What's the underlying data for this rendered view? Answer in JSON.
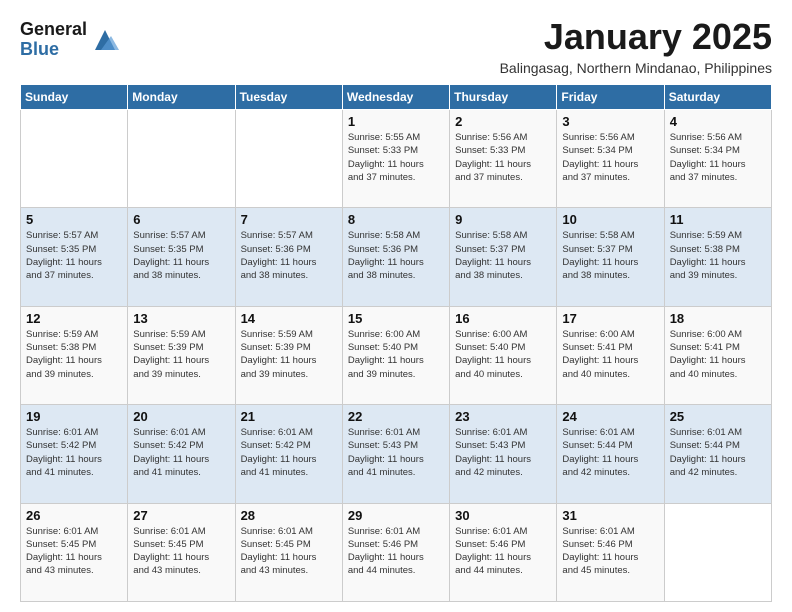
{
  "logo": {
    "line1": "General",
    "line2": "Blue"
  },
  "title": "January 2025",
  "subtitle": "Balingasag, Northern Mindanao, Philippines",
  "days_of_week": [
    "Sunday",
    "Monday",
    "Tuesday",
    "Wednesday",
    "Thursday",
    "Friday",
    "Saturday"
  ],
  "weeks": [
    [
      {
        "day": "",
        "info": ""
      },
      {
        "day": "",
        "info": ""
      },
      {
        "day": "",
        "info": ""
      },
      {
        "day": "1",
        "info": "Sunrise: 5:55 AM\nSunset: 5:33 PM\nDaylight: 11 hours\nand 37 minutes."
      },
      {
        "day": "2",
        "info": "Sunrise: 5:56 AM\nSunset: 5:33 PM\nDaylight: 11 hours\nand 37 minutes."
      },
      {
        "day": "3",
        "info": "Sunrise: 5:56 AM\nSunset: 5:34 PM\nDaylight: 11 hours\nand 37 minutes."
      },
      {
        "day": "4",
        "info": "Sunrise: 5:56 AM\nSunset: 5:34 PM\nDaylight: 11 hours\nand 37 minutes."
      }
    ],
    [
      {
        "day": "5",
        "info": "Sunrise: 5:57 AM\nSunset: 5:35 PM\nDaylight: 11 hours\nand 37 minutes."
      },
      {
        "day": "6",
        "info": "Sunrise: 5:57 AM\nSunset: 5:35 PM\nDaylight: 11 hours\nand 38 minutes."
      },
      {
        "day": "7",
        "info": "Sunrise: 5:57 AM\nSunset: 5:36 PM\nDaylight: 11 hours\nand 38 minutes."
      },
      {
        "day": "8",
        "info": "Sunrise: 5:58 AM\nSunset: 5:36 PM\nDaylight: 11 hours\nand 38 minutes."
      },
      {
        "day": "9",
        "info": "Sunrise: 5:58 AM\nSunset: 5:37 PM\nDaylight: 11 hours\nand 38 minutes."
      },
      {
        "day": "10",
        "info": "Sunrise: 5:58 AM\nSunset: 5:37 PM\nDaylight: 11 hours\nand 38 minutes."
      },
      {
        "day": "11",
        "info": "Sunrise: 5:59 AM\nSunset: 5:38 PM\nDaylight: 11 hours\nand 39 minutes."
      }
    ],
    [
      {
        "day": "12",
        "info": "Sunrise: 5:59 AM\nSunset: 5:38 PM\nDaylight: 11 hours\nand 39 minutes."
      },
      {
        "day": "13",
        "info": "Sunrise: 5:59 AM\nSunset: 5:39 PM\nDaylight: 11 hours\nand 39 minutes."
      },
      {
        "day": "14",
        "info": "Sunrise: 5:59 AM\nSunset: 5:39 PM\nDaylight: 11 hours\nand 39 minutes."
      },
      {
        "day": "15",
        "info": "Sunrise: 6:00 AM\nSunset: 5:40 PM\nDaylight: 11 hours\nand 39 minutes."
      },
      {
        "day": "16",
        "info": "Sunrise: 6:00 AM\nSunset: 5:40 PM\nDaylight: 11 hours\nand 40 minutes."
      },
      {
        "day": "17",
        "info": "Sunrise: 6:00 AM\nSunset: 5:41 PM\nDaylight: 11 hours\nand 40 minutes."
      },
      {
        "day": "18",
        "info": "Sunrise: 6:00 AM\nSunset: 5:41 PM\nDaylight: 11 hours\nand 40 minutes."
      }
    ],
    [
      {
        "day": "19",
        "info": "Sunrise: 6:01 AM\nSunset: 5:42 PM\nDaylight: 11 hours\nand 41 minutes."
      },
      {
        "day": "20",
        "info": "Sunrise: 6:01 AM\nSunset: 5:42 PM\nDaylight: 11 hours\nand 41 minutes."
      },
      {
        "day": "21",
        "info": "Sunrise: 6:01 AM\nSunset: 5:42 PM\nDaylight: 11 hours\nand 41 minutes."
      },
      {
        "day": "22",
        "info": "Sunrise: 6:01 AM\nSunset: 5:43 PM\nDaylight: 11 hours\nand 41 minutes."
      },
      {
        "day": "23",
        "info": "Sunrise: 6:01 AM\nSunset: 5:43 PM\nDaylight: 11 hours\nand 42 minutes."
      },
      {
        "day": "24",
        "info": "Sunrise: 6:01 AM\nSunset: 5:44 PM\nDaylight: 11 hours\nand 42 minutes."
      },
      {
        "day": "25",
        "info": "Sunrise: 6:01 AM\nSunset: 5:44 PM\nDaylight: 11 hours\nand 42 minutes."
      }
    ],
    [
      {
        "day": "26",
        "info": "Sunrise: 6:01 AM\nSunset: 5:45 PM\nDaylight: 11 hours\nand 43 minutes."
      },
      {
        "day": "27",
        "info": "Sunrise: 6:01 AM\nSunset: 5:45 PM\nDaylight: 11 hours\nand 43 minutes."
      },
      {
        "day": "28",
        "info": "Sunrise: 6:01 AM\nSunset: 5:45 PM\nDaylight: 11 hours\nand 43 minutes."
      },
      {
        "day": "29",
        "info": "Sunrise: 6:01 AM\nSunset: 5:46 PM\nDaylight: 11 hours\nand 44 minutes."
      },
      {
        "day": "30",
        "info": "Sunrise: 6:01 AM\nSunset: 5:46 PM\nDaylight: 11 hours\nand 44 minutes."
      },
      {
        "day": "31",
        "info": "Sunrise: 6:01 AM\nSunset: 5:46 PM\nDaylight: 11 hours\nand 45 minutes."
      },
      {
        "day": "",
        "info": ""
      }
    ]
  ]
}
